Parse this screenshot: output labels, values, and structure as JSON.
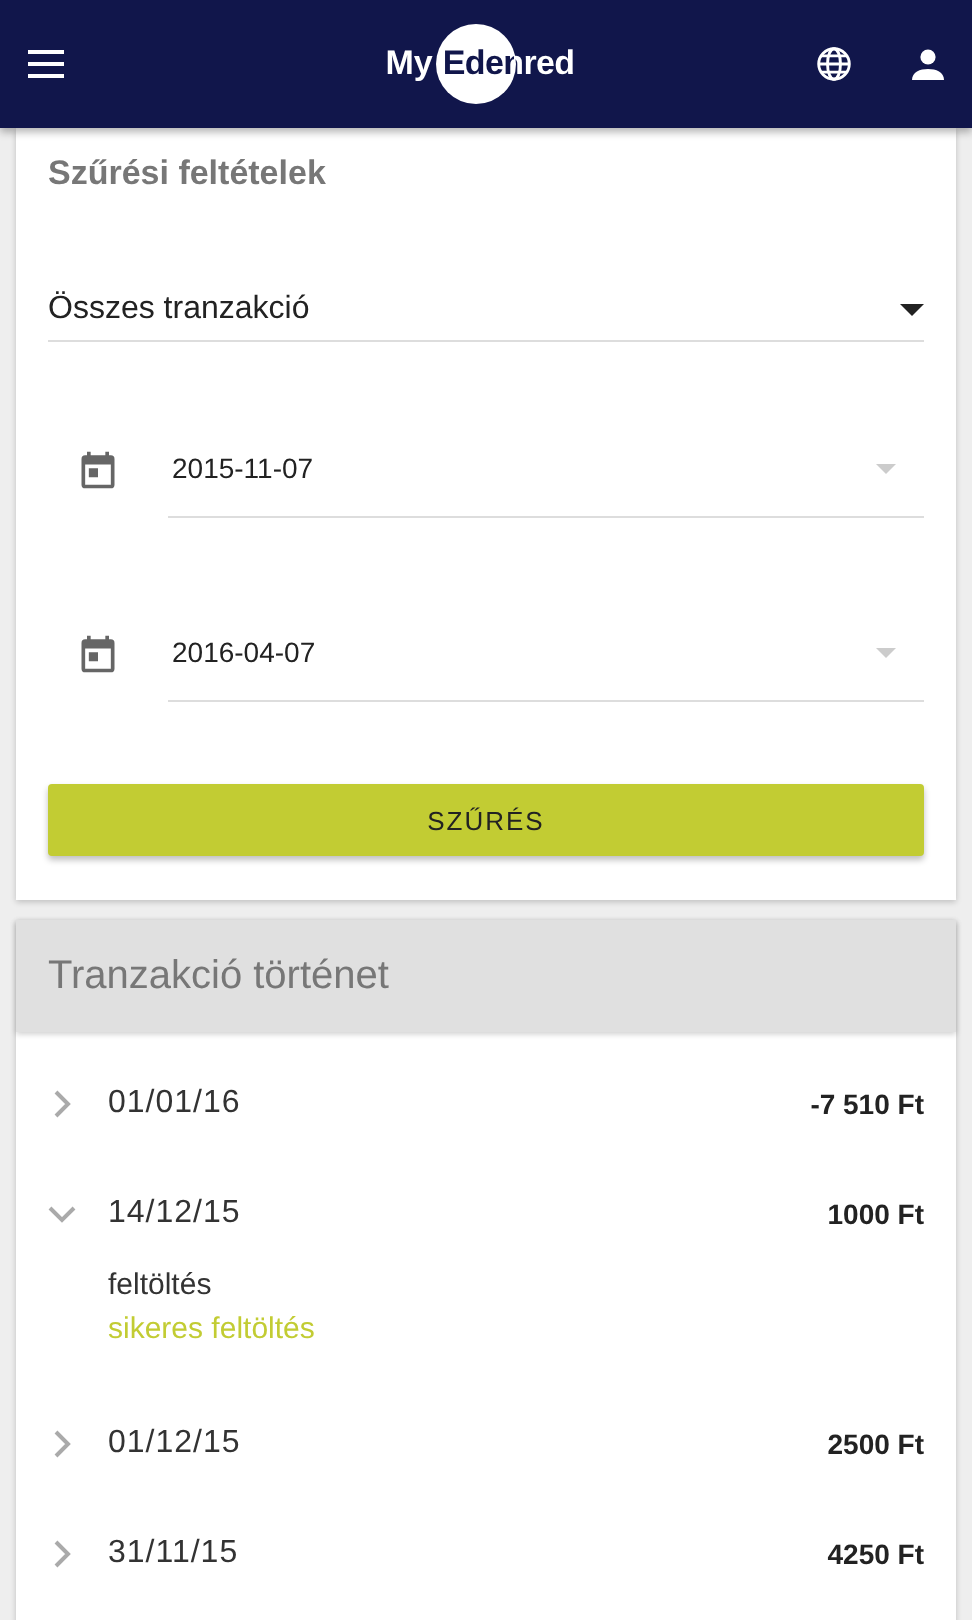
{
  "header": {
    "logo_prefix": "My",
    "logo_name": "Edenred"
  },
  "filter": {
    "title": "Szűrési feltételek",
    "type_select": "Összes tranzakció",
    "date_from": "2015-11-07",
    "date_to": "2016-04-07",
    "button": "SZŰRÉS"
  },
  "history": {
    "title": "Tranzakció történet",
    "transactions": [
      {
        "date": "01/01/16",
        "amount": "-7 510 Ft",
        "expanded": false
      },
      {
        "date": "14/12/15",
        "amount": "1000 Ft",
        "expanded": true,
        "type": "feltöltés",
        "status": "sikeres feltöltés"
      },
      {
        "date": "01/12/15",
        "amount": "2500 Ft",
        "expanded": false
      },
      {
        "date": "31/11/15",
        "amount": "4250 Ft",
        "expanded": false
      }
    ]
  }
}
